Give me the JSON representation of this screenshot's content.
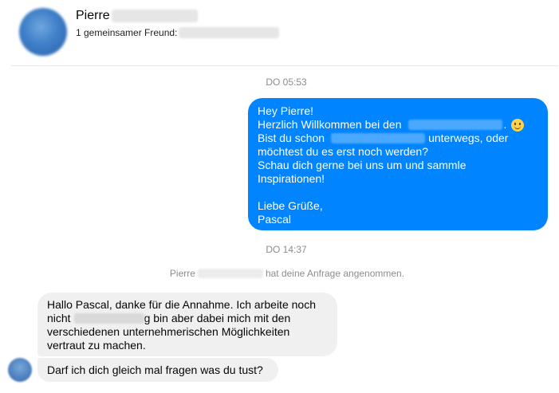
{
  "header": {
    "name": "Pierre",
    "mutual_friends": "1 gemeinsamer Freund:"
  },
  "timestamps": {
    "first": "DO 05:53",
    "second": "DO 14:37"
  },
  "outgoing_message": {
    "line1": "Hey Pierre!",
    "line2_before": "Herzlich Willkommen bei den",
    "line2_after": ".",
    "line3_before": "Bist du schon",
    "line3_after": "unterwegs, oder",
    "line4": "möchtest du es erst noch werden?",
    "line5": "Schau dich gerne bei uns um und sammle",
    "line6": "Inspirationen!",
    "line8": "Liebe Grüße,",
    "line9": "Pascal"
  },
  "system_message": {
    "name": "Pierre",
    "text": "hat deine Anfrage angenommen."
  },
  "incoming_messages": {
    "msg1_line1": "Hallo Pascal, danke für die Annahme. Ich arbeite noch",
    "msg1_line2_before": "nicht",
    "msg1_line2_after": "g bin aber dabei mich mit den",
    "msg1_line3": "verschiedenen unternehmerischen Möglichkeiten",
    "msg1_line4": "vertraut zu machen.",
    "msg2": "Darf ich dich gleich mal fragen was du tust?"
  },
  "colors": {
    "outgoing_bubble": "#0084ff",
    "incoming_bubble": "#f0f0f0",
    "timestamp_text": "#8a8d91"
  },
  "icons": {
    "emoji": "slightly-smiling-face-icon"
  }
}
